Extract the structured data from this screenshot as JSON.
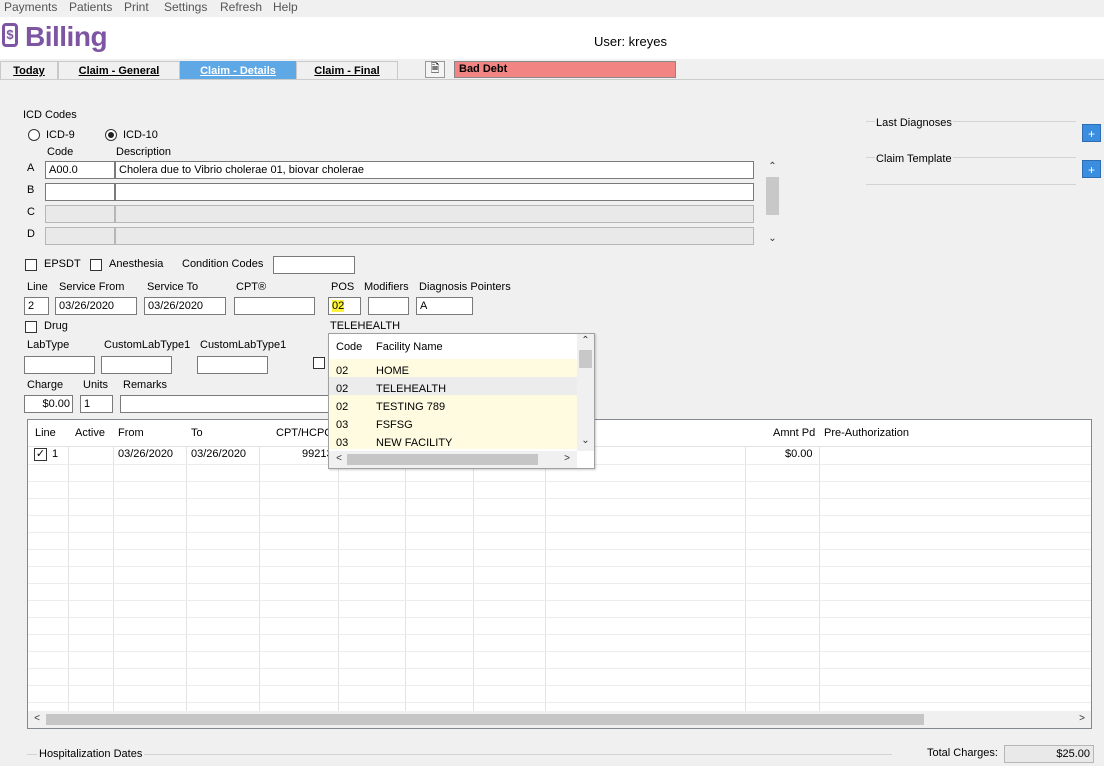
{
  "menu": [
    "Payments",
    "Patients",
    "Print",
    "Settings",
    "Refresh",
    "Help"
  ],
  "app": {
    "title": "Billing",
    "user": "User: kreyes"
  },
  "tabs": [
    {
      "label": "Today",
      "active": false
    },
    {
      "label": "Claim - General",
      "active": false
    },
    {
      "label": "Claim - Details",
      "active": true
    },
    {
      "label": "Claim - Final",
      "active": false
    }
  ],
  "bad_debt": "Bad Debt",
  "icd": {
    "title": "ICD Codes",
    "icd9": "ICD-9",
    "icd10": "ICD-10",
    "selected": "ICD-10",
    "code_header": "Code",
    "desc_header": "Description",
    "rows": [
      {
        "letter": "A",
        "code": "A00.0",
        "desc": "Cholera due to Vibrio cholerae 01, biovar cholerae"
      },
      {
        "letter": "B",
        "code": "",
        "desc": ""
      },
      {
        "letter": "C",
        "code": "",
        "desc": ""
      },
      {
        "letter": "D",
        "code": "",
        "desc": ""
      }
    ]
  },
  "right_panel": {
    "last_diagnoses": "Last Diagnoses",
    "claim_template": "Claim Template",
    "plus": "+"
  },
  "flags": {
    "epsdt": "EPSDT",
    "anesthesia": "Anesthesia",
    "condition_codes": "Condition Codes"
  },
  "line": {
    "labels": {
      "line": "Line",
      "service_from": "Service From",
      "service_to": "Service To",
      "cpt": "CPT®",
      "pos": "POS",
      "modifiers": "Modifiers",
      "diagnosis_pointers": "Diagnosis Pointers"
    },
    "values": {
      "line": "2",
      "service_from": "03/26/2020",
      "service_to": "03/26/2020",
      "cpt": "",
      "pos": "02",
      "modifiers": "",
      "diagnosis_pointers": "A"
    },
    "pos_desc": "TELEHEALTH",
    "drug": "Drug",
    "labtype": "LabType",
    "custom1": "CustomLabType1",
    "custom2": "CustomLabType1",
    "charge_label": "Charge",
    "units_label": "Units",
    "remarks_label": "Remarks",
    "charge": "$0.00",
    "units": "1"
  },
  "pos_popup": {
    "headers": {
      "code": "Code",
      "name": "Facility Name"
    },
    "rows": [
      {
        "code": "02",
        "name": "HOME"
      },
      {
        "code": "02",
        "name": "TELEHEALTH"
      },
      {
        "code": "02",
        "name": "TESTING 789"
      },
      {
        "code": "03",
        "name": "FSFSG"
      },
      {
        "code": "03",
        "name": "NEW FACILITY"
      }
    ]
  },
  "grid": {
    "headers": {
      "line": "Line",
      "active": "Active",
      "from": "From",
      "to": "To",
      "cpt": "CPT/HCPCS",
      "amnt_pd": "Amnt Pd",
      "pre_auth": "Pre-Authorization"
    },
    "rows": [
      {
        "line": "1",
        "from": "03/26/2020",
        "to": "03/26/2020",
        "cpt": "99213",
        "amnt_pd": "$0.00"
      }
    ]
  },
  "footer": {
    "hospitalization": "Hospitalization Dates",
    "total_label": "Total Charges:",
    "total": "$25.00"
  },
  "colors": {
    "brand": "#7d55a3",
    "active_tab": "#5fa8e6",
    "bad_debt": "#f28484",
    "highlight": "#fff43c",
    "plus_btn": "#3b8de0"
  }
}
